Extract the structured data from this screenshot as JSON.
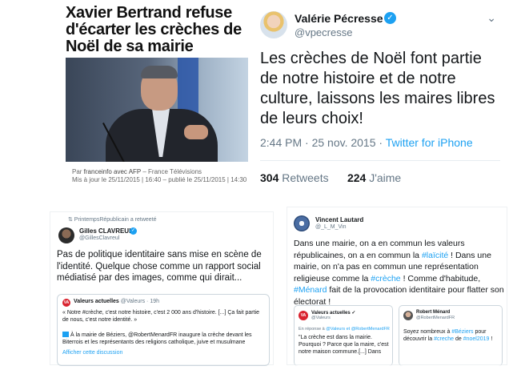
{
  "article": {
    "title": "Xavier Bertrand refuse d'écarter les crèches de Noël de sa mairie",
    "credit_line1_prefix": "Par ",
    "credit_source": "franceinfo avec AFP",
    "credit_line1_suffix": " – France Télévisions",
    "credit_line2": "Mis à jour le 25/11/2015 | 16:40 – publié le 25/11/2015 | 14:30"
  },
  "tweet_main": {
    "name": "Valérie Pécresse",
    "handle": "@vpecresse",
    "verified_glyph": "✓",
    "menu_glyph": "⌄",
    "text": "Les crèches de Noël font partie de notre histoire et de notre culture, laissons les maires libres de leurs choix!",
    "time": "2:44 PM · 25 nov. 2015 · ",
    "client": "Twitter for iPhone",
    "retweets_count": "304",
    "retweets_label": " Retweets",
    "likes_count": "224",
    "likes_label": " J'aime"
  },
  "tweet_gilles": {
    "retweet_note": "⇅  PrintempsRépublicain a retweeté",
    "name": "Gilles CLAVREUL",
    "verified_glyph": "✓",
    "handle": "@GillesClavreul",
    "text": "Pas de politique identitaire sans mise en scène de l'identité. Quelque chose comme un rapport social médiatisé par des images, comme qui dirait...",
    "quote": {
      "logo": "VA",
      "name": "Valeurs actuelles",
      "handle_time": " @Valeurs · 19h",
      "text": "« Notre #crèche, c'est notre histoire, c'est 2 000 ans d'histoire. [...] Ça fait partie de nous, c'est notre identité. »",
      "text2": "À la mairie de Béziers, @RobertMenardFR inaugure la crèche devant les Biterrois et les représentants des religions catholique, juive et musulmane",
      "link": "Afficher cette discussion"
    }
  },
  "tweet_vincent": {
    "name": "Vincent Lautard",
    "handle": "@_L_M_Vin",
    "text_parts": {
      "p1": "Dans une mairie, on a en commun les valeurs républicaines, on a en commun la ",
      "tag1": "#laïcité",
      "p2": " ! Dans une mairie, on n'a pas en commun une représentation religieuse comme la ",
      "tag2": "#crèche",
      "p3": " ! Comme d'habitude, ",
      "tag3": "#Ménard",
      "p4": " fait de la provocation identitaire pour flatter son électorat !"
    },
    "card1": {
      "logo": "VA",
      "name": "Valeurs actuelles ✓",
      "handle": "@Valeurs",
      "reply_prefix": "En réponse à ",
      "reply_handles": "@Valeurs et @RobertMenardFR",
      "text": "\"La crèche est dans la mairie. Pourquoi ? Parce que la maire, c'est notre maison commune.[...] Dans"
    },
    "card2": {
      "name": "Robert Ménard",
      "handle": "@RobertMenardFR",
      "text_p1": "Soyez nombreux à ",
      "tag1": "#Béziers",
      "text_p2": " pour découvrir la ",
      "tag2": "#creche",
      "text_p3": " de ",
      "tag3": "#noel2019",
      "text_p4": " !"
    }
  }
}
